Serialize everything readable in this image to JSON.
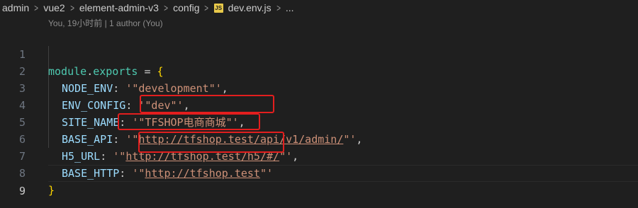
{
  "breadcrumb": {
    "items": [
      "admin",
      "vue2",
      "element-admin-v3",
      "config"
    ],
    "file_icon": "JS",
    "file_name": "dev.env.js",
    "more": "..."
  },
  "codelens": "You, 19小时前 | 1 author (You)",
  "lines": [
    {
      "num": "1",
      "kw": "module",
      "dot": ".",
      "prop": "exports",
      "op": " = ",
      "brace": "{"
    },
    {
      "num": "2",
      "key": "NODE_ENV",
      "colon": ": ",
      "value": "'\"development\"'",
      "end": ","
    },
    {
      "num": "3",
      "key": "ENV_CONFIG",
      "colon": ": ",
      "value": "'\"dev\"'",
      "end": ","
    },
    {
      "num": "4",
      "key": "SITE_NAME",
      "colon": ": ",
      "value": "'\"TFSHOP电商商城\"'",
      "end": ","
    },
    {
      "num": "5",
      "key": "BASE_API",
      "colon": ": ",
      "value_pre": "'\"",
      "value_url": "http://tfshop.test/api/v1/admin/",
      "value_post": "\"'",
      "end": ","
    },
    {
      "num": "6",
      "key": "H5_URL",
      "colon": ": ",
      "value_pre": "'\"",
      "value_url": "http://tfshop.test/h5/#/",
      "value_post": "\"'",
      "end": ","
    },
    {
      "num": "7",
      "key": "BASE_HTTP",
      "colon": ": ",
      "value_pre": "'\"",
      "value_url": "http://tfshop.test",
      "value_post": "\"'",
      "end": ""
    },
    {
      "num": "8",
      "brace": "}"
    },
    {
      "num": "9"
    }
  ],
  "colors": {
    "background": "#1f1f1f",
    "keyword": "#4ec9b0",
    "property": "#9cdcfe",
    "string": "#ce9178",
    "brace": "#ffd700",
    "highlight_box": "#e31e1e"
  }
}
